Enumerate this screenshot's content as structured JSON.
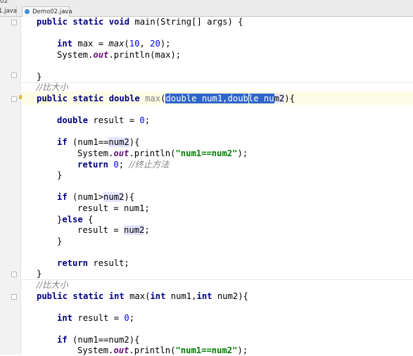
{
  "tabs": {
    "header_fragment": "02",
    "tab1_label": "1.java",
    "tab2_label": "Demo02.java",
    "close_glyph": "×"
  },
  "code": {
    "l1": {
      "k1": "public static void ",
      "t": "main(String[] args) {"
    },
    "l2": {
      "k": "int ",
      "t1": "max = ",
      "m": "max",
      "t2": "(",
      "n1": "10",
      "t3": ", ",
      "n2": "20",
      "t4": ");"
    },
    "l3": {
      "t1": "System.",
      "st": "out",
      "t2": ".println(max);"
    },
    "l4": "}",
    "c1": "//比大小",
    "l5": {
      "k": "public static double ",
      "ph": "max",
      "t1": "(",
      "s1": "double",
      "s2": " num1,",
      "s3": "double",
      "s4": " nu",
      "s5": "m2",
      "t2": "){"
    },
    "l6": {
      "k": "double ",
      "t1": "result = ",
      "n": "0",
      "t2": ";"
    },
    "l7": {
      "k": "if ",
      "t1": "(num1==",
      "r": "num2",
      "t2": "){"
    },
    "l8": {
      "t1": "System.",
      "st": "out",
      "t2": ".println(",
      "s": "\"num1==num2\"",
      "t3": ");"
    },
    "l9": {
      "k": "return ",
      "n": "0",
      "t": "; ",
      "c": "//终止方法"
    },
    "l10": "}",
    "l11": {
      "k": "if ",
      "t1": "(num1>",
      "r": "num2",
      "t2": "){"
    },
    "l12": "result = num1;",
    "l13": {
      "t1": "}",
      "k": "else ",
      "t2": "{"
    },
    "l14": {
      "t1": "result = ",
      "r": "num2",
      "t2": ";"
    },
    "l15": "}",
    "l16": {
      "k": "return ",
      "t": "result;"
    },
    "l17": "}",
    "c2": "//比大小",
    "l18": {
      "k": "public static int ",
      "t1": "max(",
      "k2": "int ",
      "t2": "num1,",
      "k3": "int ",
      "t3": "num2){"
    },
    "l19": {
      "k": "int ",
      "t1": "result = ",
      "n": "0",
      "t2": ";"
    },
    "l20": {
      "k": "if ",
      "t": "(num1==num2){"
    },
    "l21": {
      "t1": "System.",
      "st": "out",
      "t2": ".println(",
      "s": "\"num1==num2\"",
      "t3": ");"
    }
  }
}
